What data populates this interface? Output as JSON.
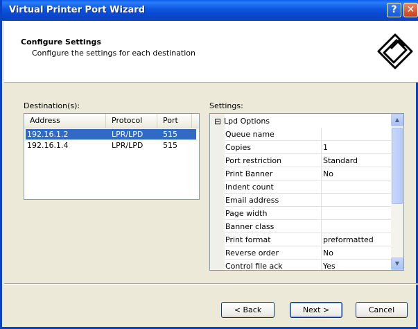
{
  "window": {
    "title": "Virtual Printer Port Wizard",
    "help_label": "?",
    "close_label": "✕"
  },
  "header": {
    "title": "Configure Settings",
    "subtitle": "Configure the settings for each destination",
    "logo_icon": "printer-setup-icon"
  },
  "destinations": {
    "label": "Destination(s):",
    "columns": [
      "Address",
      "Protocol",
      "Port"
    ],
    "rows": [
      {
        "address": "192.16.1.2",
        "protocol": "LPR/LPD",
        "port": "515",
        "selected": true
      },
      {
        "address": "192.16.1.4",
        "protocol": "LPR/LPD",
        "port": "515",
        "selected": false
      }
    ]
  },
  "settings": {
    "label": "Settings:",
    "category": {
      "expander": "⊟",
      "label": "Lpd Options"
    },
    "properties": [
      {
        "name": "Queue name",
        "value": ""
      },
      {
        "name": "Copies",
        "value": "1"
      },
      {
        "name": "Port restriction",
        "value": "Standard"
      },
      {
        "name": "Print Banner",
        "value": "No"
      },
      {
        "name": "Indent count",
        "value": ""
      },
      {
        "name": "Email address",
        "value": ""
      },
      {
        "name": "Page width",
        "value": ""
      },
      {
        "name": "Banner class",
        "value": ""
      },
      {
        "name": "Print format",
        "value": "preformatted"
      },
      {
        "name": "Reverse order",
        "value": "No"
      },
      {
        "name": "Control file ack",
        "value": "Yes"
      }
    ],
    "scroll_up": "▲",
    "scroll_down": "▼"
  },
  "buttons": {
    "back": "< Back",
    "next": "Next >",
    "cancel": "Cancel"
  }
}
